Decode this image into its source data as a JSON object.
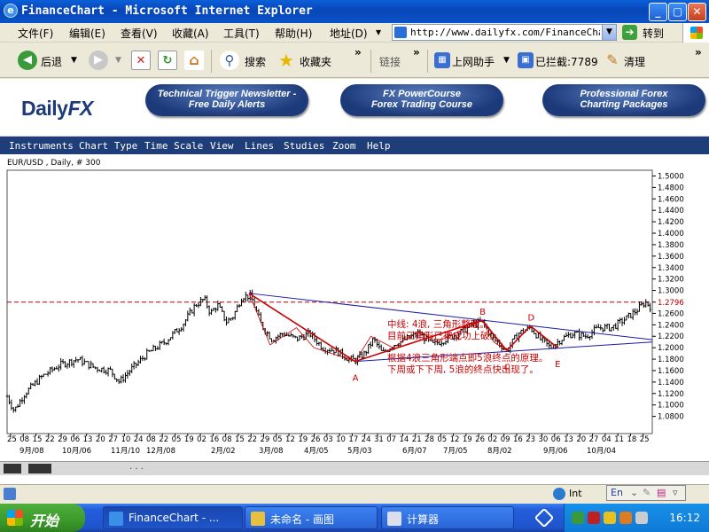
{
  "window": {
    "title": "FinanceChart - Microsoft Internet Explorer",
    "btn_minimize": "_",
    "btn_maximize": "▢",
    "btn_close": "✕"
  },
  "menubar": {
    "items": [
      "文件(F)",
      "编辑(E)",
      "查看(V)",
      "收藏(A)",
      "工具(T)",
      "帮助(H)"
    ],
    "address_label": "地址(D)",
    "address_url": "http://www.dailyfx.com/FinanceChart.",
    "go_label": "转到"
  },
  "toolbar": {
    "back": "后退",
    "search": "搜索",
    "favorites": "收藏夹",
    "links": "链接",
    "assistant": "上网助手",
    "blocked": "已拦截:7789",
    "clean": "清理",
    "more": "»"
  },
  "banner": {
    "logo_daily": "Daily",
    "logo_fx": "FX",
    "pill1_line1": "Technical Trigger Newsletter -",
    "pill1_line2": "Free Daily Alerts",
    "pill2_line1": "FX PowerCourse",
    "pill2_line2": "Forex Trading Course",
    "pill3_line1": "Professional Forex",
    "pill3_line2": "Charting Packages"
  },
  "app_menu": [
    "Instruments",
    "Chart Type",
    "Time Scale",
    "View",
    "Lines",
    "Studies",
    "Zoom",
    "Help"
  ],
  "chart_data": {
    "type": "candlestick",
    "title": "EUR/USD , Daily, # 300",
    "ylim": [
      1.05,
      1.51
    ],
    "y_ticks": [
      1.5,
      1.48,
      1.46,
      1.44,
      1.42,
      1.4,
      1.38,
      1.36,
      1.34,
      1.32,
      1.3,
      1.2796,
      1.26,
      1.24,
      1.22,
      1.2,
      1.18,
      1.16,
      1.14,
      1.12,
      1.1,
      1.08
    ],
    "y_tick_labels": [
      "1.5000",
      "1.4800",
      "1.4600",
      "1.4400",
      "1.4200",
      "1.4000",
      "1.3800",
      "1.3600",
      "1.3400",
      "1.3200",
      "1.3000",
      "1.2796",
      "1.2600",
      "1.2400",
      "1.2200",
      "1.2000",
      "1.1800",
      "1.1600",
      "1.1400",
      "1.1200",
      "1.1000",
      "1.0800"
    ],
    "current_price": 1.2796,
    "x_day_labels": [
      "25",
      "08",
      "15",
      "22",
      "29",
      "06",
      "13",
      "20",
      "27",
      "10",
      "24",
      "08",
      "22",
      "05",
      "19",
      "02",
      "16",
      "08",
      "15",
      "22",
      "29",
      "05",
      "12",
      "19",
      "26",
      "03",
      "10",
      "17",
      "24",
      "31",
      "07",
      "14",
      "21",
      "28",
      "05",
      "12",
      "19",
      "26",
      "02",
      "09",
      "16",
      "23",
      "30",
      "06",
      "13",
      "20",
      "27",
      "04",
      "11",
      "18",
      "25"
    ],
    "x_month_labels": [
      "9月/08",
      "10月/06",
      "11月/10",
      "12月/08",
      "2月/02",
      "3月/08",
      "4月/05",
      "5月/03",
      "6月/07",
      "7月/05",
      "8月/02",
      "9月/06",
      "10月/04"
    ],
    "price_path": [
      [
        0,
        1.115
      ],
      [
        8,
        1.09
      ],
      [
        20,
        1.12
      ],
      [
        40,
        1.15
      ],
      [
        60,
        1.17
      ],
      [
        80,
        1.18
      ],
      [
        100,
        1.165
      ],
      [
        118,
        1.16
      ],
      [
        128,
        1.14
      ],
      [
        140,
        1.16
      ],
      [
        160,
        1.19
      ],
      [
        180,
        1.21
      ],
      [
        200,
        1.24
      ],
      [
        215,
        1.275
      ],
      [
        225,
        1.285
      ],
      [
        232,
        1.26
      ],
      [
        240,
        1.275
      ],
      [
        250,
        1.245
      ],
      [
        258,
        1.255
      ],
      [
        268,
        1.29
      ],
      [
        278,
        1.29
      ],
      [
        290,
        1.24
      ],
      [
        302,
        1.215
      ],
      [
        315,
        1.225
      ],
      [
        330,
        1.215
      ],
      [
        345,
        1.225
      ],
      [
        360,
        1.2
      ],
      [
        375,
        1.195
      ],
      [
        390,
        1.18
      ],
      [
        398,
        1.178
      ],
      [
        408,
        1.19
      ],
      [
        418,
        1.215
      ],
      [
        428,
        1.19
      ],
      [
        440,
        1.205
      ],
      [
        455,
        1.215
      ],
      [
        470,
        1.225
      ],
      [
        485,
        1.205
      ],
      [
        500,
        1.215
      ],
      [
        515,
        1.225
      ],
      [
        530,
        1.24
      ],
      [
        542,
        1.245
      ],
      [
        555,
        1.215
      ],
      [
        570,
        1.195
      ],
      [
        583,
        1.225
      ],
      [
        597,
        1.235
      ],
      [
        608,
        1.215
      ],
      [
        620,
        1.2
      ],
      [
        632,
        1.215
      ],
      [
        645,
        1.225
      ],
      [
        660,
        1.22
      ],
      [
        675,
        1.235
      ],
      [
        690,
        1.235
      ],
      [
        705,
        1.25
      ],
      [
        718,
        1.265
      ],
      [
        728,
        1.28
      ],
      [
        734,
        1.272
      ]
    ],
    "wave_points": [
      {
        "label": "",
        "x": 276,
        "y": 1.295
      },
      {
        "label": "A",
        "x": 397,
        "y": 1.176
      },
      {
        "label": "B",
        "x": 542,
        "y": 1.248
      },
      {
        "label": "C",
        "x": 570,
        "y": 1.195
      },
      {
        "label": "D",
        "x": 597,
        "y": 1.238
      },
      {
        "label": "E",
        "x": 628,
        "y": 1.2
      }
    ],
    "triangle_upper": {
      "from": [
        276,
        1.295
      ],
      "to": [
        736,
        1.214
      ]
    },
    "triangle_lower": {
      "from": [
        397,
        1.176
      ],
      "to": [
        736,
        1.21
      ]
    },
    "annotation_lines": [
      "中线: 4浪, 三角形整理。",
      "目前三角形已被成功上破。",
      "根据4浪三角形端点即5浪终点的原理。",
      "下周或下下周, 5浪的终点快出现了。"
    ],
    "colors": {
      "candles": "#000000",
      "wave": "#cc0000",
      "triangle": "#1a1aa8",
      "annotation": "#cc0000",
      "price_line": "#aa0000"
    }
  },
  "chart_footer": {
    "dots": ". . ."
  },
  "ie_status": {
    "zone": "Int"
  },
  "taskbar": {
    "start": "开始",
    "tasks": [
      {
        "label": "FinanceChart - ...",
        "active": true
      },
      {
        "label": "未命名 - 画图",
        "active": false
      },
      {
        "label": "计算器",
        "active": false
      }
    ],
    "clock": "16:12",
    "lang": "En"
  }
}
